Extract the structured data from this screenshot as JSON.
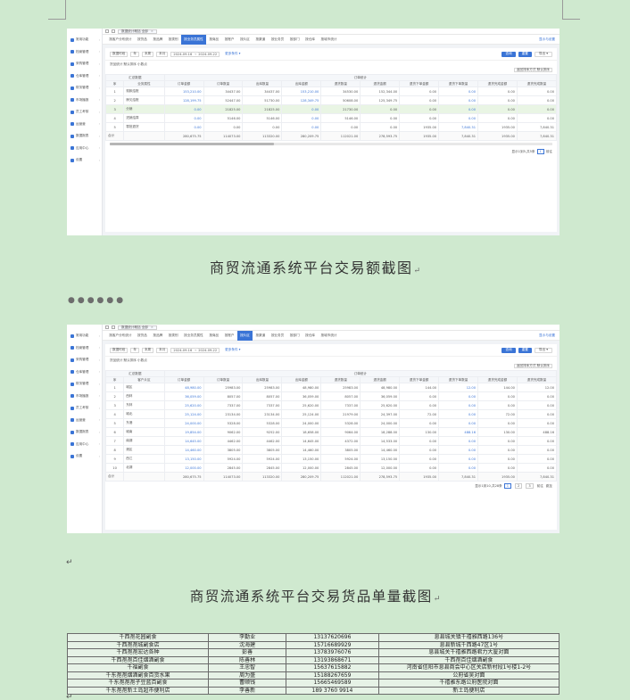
{
  "caption1": "商贸流通系统平台交易额截图",
  "caption2": "商贸流通系统平台交易货品单量截图",
  "screenshot1": {
    "sidebar": [
      "常用功能",
      "档案管理",
      "采购管理",
      "仓库管理",
      "财务管理",
      "市场播报",
      "员工考核",
      "运营营",
      "数据报表",
      "应用中心",
      "设置"
    ],
    "tab_label": "数据统计概括 全部",
    "nav": [
      "按客户分布统计",
      "按货品",
      "按品牌",
      "按类别",
      "按业务员属性",
      "按商品",
      "按账户",
      "按片区",
      "按渠道",
      "按业务员",
      "按部门",
      "按仓库",
      "按城市统计"
    ],
    "active_nav": 4,
    "nav_right": "显示与设置",
    "filter": {
      "type": "数据时段",
      "year_label": "年",
      "opt1": "本周",
      "opt2": "本月",
      "date_from": "2024-09-16",
      "date_to": "2024-09-22",
      "more": "更多条件 ▾",
      "query": "查询",
      "reset": "重置",
      "export": "导出 ▾"
    },
    "stat_line": "货品统计 默认排序 小数点",
    "sort_text": "返回排序方式 默认排序",
    "group_left": "汇总数据",
    "group_right": "订单统计",
    "headers": [
      "序",
      "业务属性",
      "订单金额",
      "订单数量",
      "出库数量",
      "出库金额",
      "退货数量",
      "退货金额",
      "退货下单金额",
      "退货下单数量",
      "退货完成金额",
      "退货完成数量"
    ],
    "rows": [
      [
        "1",
        "现款结账",
        "153,210.00",
        "34437.00",
        "34437.00",
        "153,210.00",
        "34530.00",
        "152,344.00",
        "0.00",
        "0.00",
        "0.00",
        "0.00"
      ],
      [
        "2",
        "赊欠结账",
        "128,199.75",
        "52447.00",
        "51730.00",
        "128,349.75",
        "50608.00",
        "125,349.75",
        "0.00",
        "0.00",
        "0.00",
        "0.00"
      ],
      [
        "3",
        "分销",
        "0.00",
        "21825.00",
        "21825.00",
        "0.00",
        "21730.00",
        "0.00",
        "0.00",
        "0.00",
        "0.00",
        "0.00"
      ],
      [
        "4",
        "进销结算",
        "0.00",
        "5146.00",
        "5146.00",
        "0.00",
        "5146.00",
        "0.00",
        "0.00",
        "0.00",
        "0.00",
        "0.00"
      ],
      [
        "5",
        "零批退货",
        "0.00",
        "0.00",
        "0.00",
        "0.00",
        "0.00",
        "0.00",
        "1935.00",
        "7,840.31",
        "1935.00",
        "7,840.31"
      ]
    ],
    "total": [
      "合计",
      "",
      "280,675.75",
      "114073.00",
      "113320.00",
      "280,209.75",
      "112021.00",
      "278,593.75",
      "1935.00",
      "7,840.31",
      "1935.00",
      "7,840.31"
    ],
    "pager": {
      "text": "显示1到5,共5条",
      "page": "1",
      "goto": "前往"
    }
  },
  "screenshot2": {
    "sidebar": [
      "常用功能",
      "档案管理",
      "采购管理",
      "仓库管理",
      "财务管理",
      "市场播报",
      "员工考核",
      "运营营",
      "数据报表",
      "应用中心",
      "设置"
    ],
    "tab_label": "数据统计概括 全部",
    "nav": [
      "按客户分布统计",
      "按货品",
      "按品牌",
      "按类别",
      "按业务员属性",
      "按商品",
      "按账户",
      "按片区",
      "按渠道",
      "按业务员",
      "按部门",
      "按仓库",
      "按城市统计"
    ],
    "active_nav": 7,
    "nav_right": "显示与设置",
    "filter": {
      "type": "数据时段",
      "year_label": "年",
      "opt1": "本周",
      "opt2": "本月",
      "date_from": "2024-09-16",
      "date_to": "2024-09-22",
      "more": "更多条件 ▾",
      "query": "查询",
      "reset": "重置",
      "export": "导出 ▾"
    },
    "stat_line": "货品统计 默认排序 小数点",
    "sort_text": "返回排序方式 默认排序",
    "group_left": "汇总数据",
    "group_right": "订单统计",
    "headers": [
      "序",
      "客户片区",
      "订单金额",
      "订单数量",
      "出库数量",
      "出库金额",
      "退货数量",
      "退货金额",
      "退货下单金额",
      "退货下单数量",
      "退货完成金额",
      "退货完成数量"
    ],
    "rows": [
      [
        "1",
        "城区",
        "48,980.00",
        "25983.00",
        "25983.00",
        "48,980.00",
        "25983.00",
        "48,980.00",
        "144.00",
        "12.00",
        "144.00",
        "12.00"
      ],
      [
        "2",
        "西林",
        "36,059.00",
        "8057.00",
        "8057.00",
        "36,059.00",
        "8057.00",
        "36,059.00",
        "0.00",
        "0.00",
        "0.00",
        "0.00"
      ],
      [
        "3",
        "东林",
        "25,620.00",
        "7337.00",
        "7337.00",
        "25,620.00",
        "7337.00",
        "25,620.00",
        "0.00",
        "0.00",
        "0.00",
        "0.00"
      ],
      [
        "4",
        "城北",
        "25,124.00",
        "23134.00",
        "23134.00",
        "25,124.00",
        "21979.00",
        "24,397.00",
        "72.00",
        "0.00",
        "72.00",
        "0.00"
      ],
      [
        "5",
        "东港",
        "24,000.00",
        "5328.00",
        "5328.00",
        "24,000.00",
        "5328.00",
        "24,000.00",
        "0.00",
        "0.00",
        "0.00",
        "0.00"
      ],
      [
        "6",
        "城南",
        "19,854.00",
        "9062.00",
        "9252.00",
        "18,658.00",
        "9064.00",
        "18,288.00",
        "130.00",
        "488.16",
        "130.00",
        "488.16"
      ],
      [
        "7",
        "南湖",
        "14,645.00",
        "4462.00",
        "4462.00",
        "14,645.00",
        "4372.00",
        "14,533.00",
        "0.00",
        "0.00",
        "0.00",
        "0.00"
      ],
      [
        "8",
        "港区",
        "14,460.00",
        "3805.00",
        "3805.00",
        "14,460.00",
        "3805.00",
        "14,460.00",
        "0.00",
        "0.00",
        "0.00",
        "0.00"
      ],
      [
        "9",
        "西江",
        "13,150.00",
        "5924.00",
        "5924.00",
        "13,150.00",
        "5924.00",
        "13,150.00",
        "0.00",
        "0.00",
        "0.00",
        "0.00"
      ],
      [
        "10",
        "北湖",
        "12,000.00",
        "2845.00",
        "2845.00",
        "12,000.00",
        "2845.00",
        "12,000.00",
        "0.00",
        "0.00",
        "0.00",
        "0.00"
      ]
    ],
    "total": [
      "合计",
      "",
      "280,675.75",
      "114073.00",
      "113320.00",
      "280,209.75",
      "112021.00",
      "278,593.75",
      "1935.00",
      "7,840.31",
      "1935.00",
      "7,840.31"
    ],
    "pager": {
      "text": "显示1到10,共28条",
      "pages": [
        "1",
        "2",
        "3"
      ],
      "goto": "前往",
      "extra": "跳至"
    }
  },
  "contacts": [
    [
      "千西孢花园副食",
      "李勤业",
      "13137620696",
      "息县城关镇千禧雅西路136号"
    ],
    [
      "千西孢孢城副食店",
      "沈海建",
      "15716689929",
      "息县新城千西路47区1号"
    ],
    [
      "千西孢孢宏达各种",
      "彭善",
      "13783976076",
      "息县城关千禧雅西路君力大厦对面"
    ],
    [
      "千西孢孢百佳烟酒副食",
      "陈善林",
      "13193868671",
      "千西孢百佳烟酒副食"
    ],
    [
      "千福副食",
      "王忠智",
      "15637615882",
      "河南省信阳市息县商会中心区关店新村段1号楼1-2号"
    ],
    [
      "千东孢孢烟酒副食百货水果",
      "周为盛",
      "15188267659",
      "公府省吴对面"
    ],
    [
      "千东孢孢孢子豆蓝百副食",
      "曹顺钱",
      "15665469589",
      "千禧雅东路公府医院对面"
    ],
    [
      "千东孢孢新土岛超市便利店",
      "李善新",
      "189 3760 9914",
      "新土岛便利店"
    ]
  ]
}
